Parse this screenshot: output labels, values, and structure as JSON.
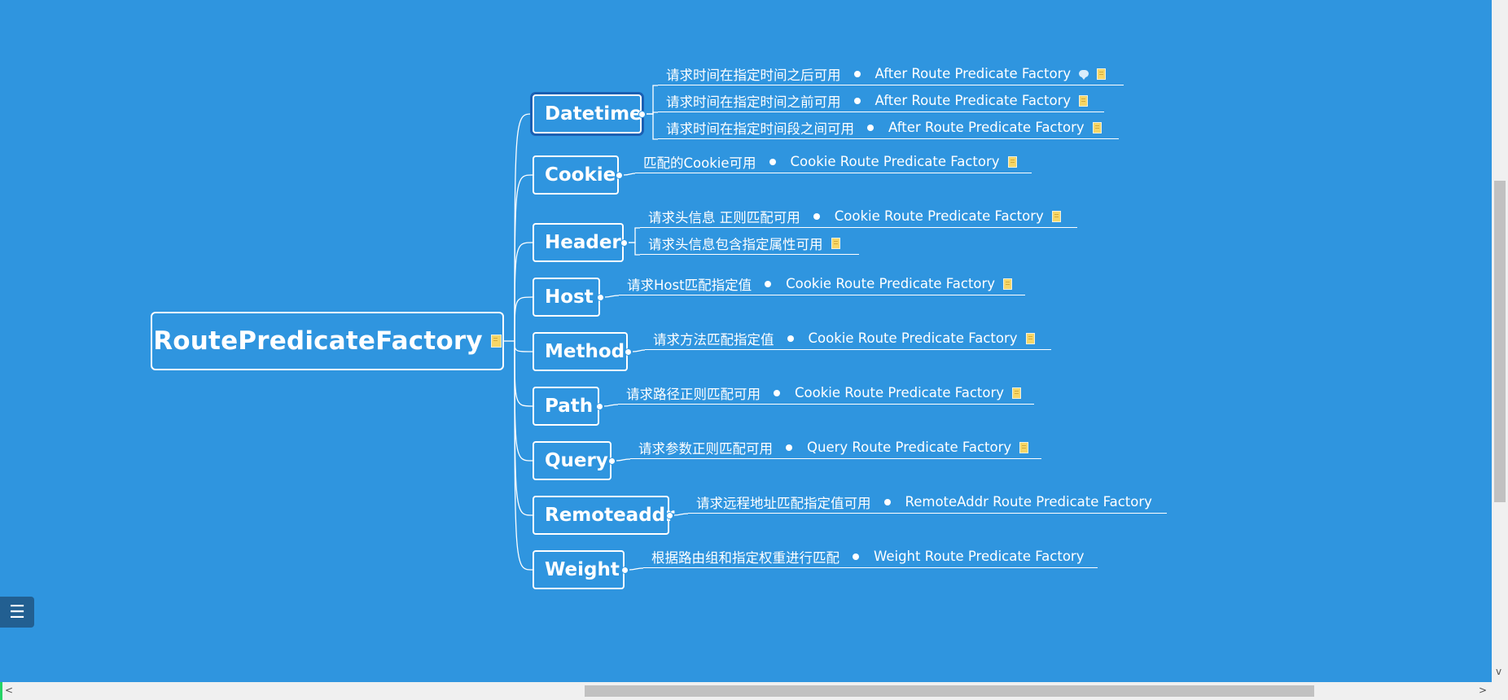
{
  "mindmap": {
    "root": {
      "label": "RoutePredicateFactory",
      "has_note": true
    },
    "branches": [
      {
        "label": "Datetime",
        "selected": true,
        "leaves": [
          {
            "desc": "请求时间在指定时间之后可用",
            "name": "After Route Predicate Factory",
            "comment": true,
            "note": true
          },
          {
            "desc": "请求时间在指定时间之前可用",
            "name": "After Route Predicate Factory",
            "comment": false,
            "note": true
          },
          {
            "desc": "请求时间在指定时间段之间可用",
            "name": "After Route Predicate Factory",
            "comment": false,
            "note": true
          }
        ]
      },
      {
        "label": "Cookie",
        "leaves": [
          {
            "desc": "匹配的Cookie可用",
            "name": "Cookie Route Predicate Factory",
            "comment": false,
            "note": true
          }
        ]
      },
      {
        "label": "Header",
        "leaves": [
          {
            "desc": "请求头信息 正则匹配可用",
            "name": "Cookie Route Predicate Factory",
            "comment": false,
            "note": true
          },
          {
            "desc": "请求头信息包含指定属性可用",
            "name": "",
            "comment": false,
            "note": true
          }
        ]
      },
      {
        "label": "Host",
        "leaves": [
          {
            "desc": "请求Host匹配指定值",
            "name": "Cookie Route Predicate Factory",
            "comment": false,
            "note": true
          }
        ]
      },
      {
        "label": "Method",
        "leaves": [
          {
            "desc": "请求方法匹配指定值",
            "name": "Cookie Route Predicate Factory",
            "comment": false,
            "note": true
          }
        ]
      },
      {
        "label": "Path",
        "leaves": [
          {
            "desc": "请求路径正则匹配可用",
            "name": "Cookie Route Predicate Factory",
            "comment": false,
            "note": true
          }
        ]
      },
      {
        "label": "Query",
        "leaves": [
          {
            "desc": "请求参数正则匹配可用",
            "name": "Query Route Predicate Factory",
            "comment": false,
            "note": true
          }
        ]
      },
      {
        "label": "Remoteaddr",
        "leaves": [
          {
            "desc": "请求远程地址匹配指定值可用",
            "name": "RemoteAddr Route Predicate Factory",
            "comment": false,
            "note": false
          }
        ]
      },
      {
        "label": "Weight",
        "leaves": [
          {
            "desc": "根据路由组和指定权重进行匹配",
            "name": "Weight Route Predicate Factory",
            "comment": false,
            "note": false
          }
        ]
      }
    ]
  },
  "toolbar": {
    "outline_icon": "list-outline-icon"
  },
  "scrollbars": {
    "left_arrow": "<",
    "right_arrow": ">",
    "down_arrow": "v"
  },
  "colors": {
    "background": "#2f95df",
    "selected_border": "#1a5fb3",
    "note": "#f6d667"
  }
}
